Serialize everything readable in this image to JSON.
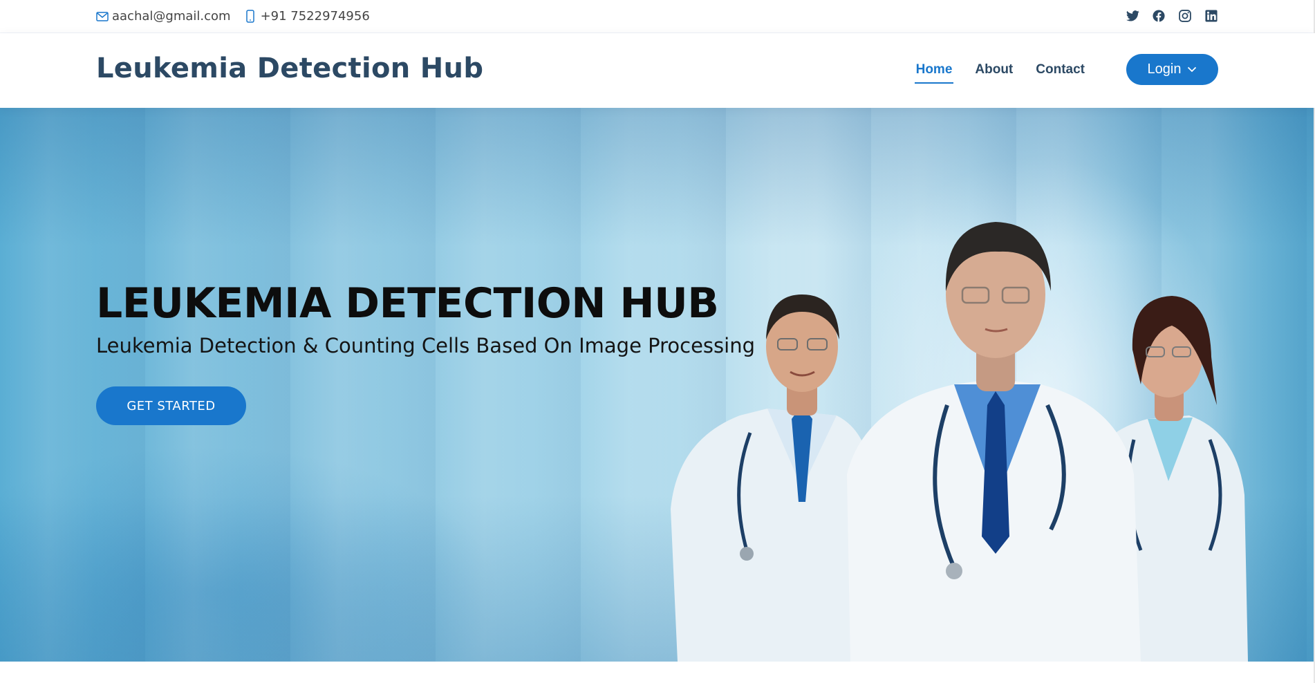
{
  "topbar": {
    "email": "aachal@gmail.com",
    "phone": "+91 7522974956",
    "email_icon": "envelope-icon",
    "phone_icon": "phone-icon",
    "social": [
      "twitter-icon",
      "facebook-icon",
      "instagram-icon",
      "linkedin-icon"
    ]
  },
  "header": {
    "logo": "Leukemia Detection Hub",
    "nav": [
      {
        "label": "Home",
        "active": true
      },
      {
        "label": "About",
        "active": false
      },
      {
        "label": "Contact",
        "active": false
      }
    ],
    "login_label": "Login"
  },
  "hero": {
    "title": "LEUKEMIA DETECTION HUB",
    "subtitle": "Leukemia Detection & Counting Cells Based On Image Processing",
    "cta_label": "GET STARTED"
  },
  "colors": {
    "accent": "#1977cc",
    "heading": "#2c4964",
    "text": "#444444"
  }
}
